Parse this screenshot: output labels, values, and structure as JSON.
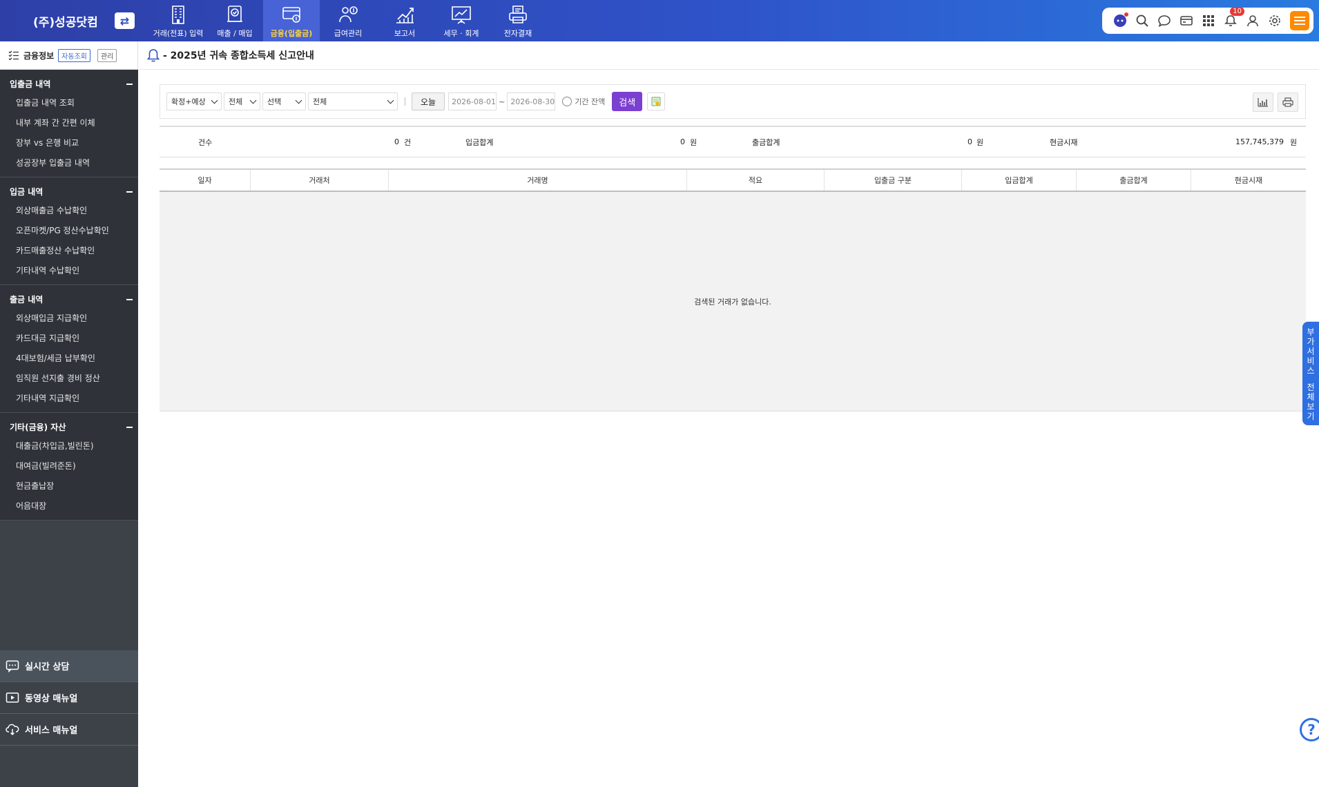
{
  "header": {
    "company": "(주)성공닷컴",
    "switch_icon": "⇄",
    "nav": [
      {
        "label": "거래(전표) 입력",
        "icon": "building-icon"
      },
      {
        "label": "매출 / 매입",
        "icon": "invoice-check-icon"
      },
      {
        "label": "금융(입출금)",
        "icon": "card-coin-icon",
        "active": true
      },
      {
        "label": "급여관리",
        "icon": "payroll-person-icon"
      },
      {
        "label": "보고서",
        "icon": "report-chart-icon"
      },
      {
        "label": "세무 · 회계",
        "icon": "presentation-icon"
      },
      {
        "label": "전자결재",
        "icon": "printer-doc-icon"
      }
    ],
    "notifications_count": "10"
  },
  "sidebar": {
    "title": "금융정보",
    "chip_auto": "자동조회",
    "chip_manage": "관리",
    "groups": [
      {
        "title": "입출금 내역",
        "items": [
          "입출금 내역 조회",
          "내부 계좌 간 간편 이체",
          "장부 vs 은행 비교",
          "성공장부 입출금 내역"
        ]
      },
      {
        "title": "입금 내역",
        "items": [
          "외상매출금 수납확인",
          "오픈마켓/PG 정산수납확인",
          "카드매출정산 수납확인",
          "기타내역 수납확인"
        ]
      },
      {
        "title": "출금 내역",
        "items": [
          "외상매입금 지급확인",
          "카드대금 지급확인",
          "4대보험/세금 납부확인",
          "임직원 선지출 경비 정산",
          "기타내역 지급확인"
        ]
      },
      {
        "title": "기타(금융) 자산",
        "items": [
          "대출금(차입금,빌린돈)",
          "대여금(빌려준돈)",
          "현금출납장",
          "어음대장"
        ]
      }
    ],
    "bottom": {
      "chat": "실시간 상담",
      "video": "동영상 매뉴얼",
      "service": "서비스 매뉴얼"
    }
  },
  "notice": {
    "text": "- 2025년 귀속 종합소득세 신고안내"
  },
  "filter": {
    "sel1": "확정+예상",
    "sel2": "전체",
    "sel3": "선택",
    "sel4": "전체",
    "today": "오늘",
    "date_from": "2026-08-01",
    "date_to": "2026-08-30",
    "tilde": "~",
    "period_balance": "기간 잔액",
    "search": "검색"
  },
  "summary": {
    "count_label": "건수",
    "count_value": "0",
    "count_unit": "건",
    "in_label": "입금합계",
    "in_value": "0",
    "in_unit": "원",
    "out_label": "출금합계",
    "out_value": "0",
    "out_unit": "원",
    "cash_label": "현금시재",
    "cash_value": "157,745,379",
    "cash_unit": "원"
  },
  "table": {
    "columns": [
      "일자",
      "거래처",
      "거래명",
      "적요",
      "입출금 구분",
      "입금합계",
      "출금합계",
      "현금시재"
    ],
    "empty": "검색된 거래가 없습니다."
  },
  "side_tab": {
    "line1": [
      "부",
      "가",
      "서",
      "비",
      "스"
    ],
    "line2": [
      "전",
      "체",
      "보",
      "기"
    ]
  },
  "help": "?"
}
